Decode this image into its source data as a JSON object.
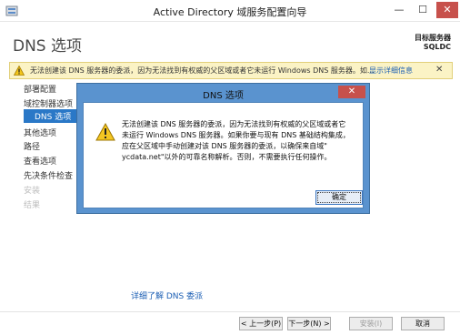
{
  "window": {
    "title": "Active Directory 域服务配置向导",
    "min_label": "—",
    "max_label": "☐",
    "close_label": "✕"
  },
  "header": {
    "page_title": "DNS 选项",
    "target_label": "目标服务器",
    "target_server": "SQLDC"
  },
  "warning": {
    "text": "无法创建该 DNS 服务器的委派，因为无法找到有权威的父区域或者它未运行 Windows DNS 服务器。如...",
    "link": "显示详细信息",
    "close": "✕"
  },
  "sidebar": {
    "items": [
      {
        "label": "部署配置",
        "state": "normal"
      },
      {
        "label": "域控制器选项",
        "state": "normal"
      },
      {
        "label": "DNS 选项",
        "state": "active"
      },
      {
        "label": "其他选项",
        "state": "normal"
      },
      {
        "label": "路径",
        "state": "normal"
      },
      {
        "label": "查看选项",
        "state": "normal"
      },
      {
        "label": "先决条件检查",
        "state": "normal"
      },
      {
        "label": "安装",
        "state": "disabled"
      },
      {
        "label": "结果",
        "state": "disabled"
      }
    ]
  },
  "main": {
    "learn_more": "详细了解 DNS 委派"
  },
  "footer": {
    "prev": "< 上一步(P)",
    "next": "下一步(N) >",
    "install": "安装(I)",
    "cancel": "取消"
  },
  "modal": {
    "title": "DNS 选项",
    "close": "✕",
    "message_lines": [
      "无法创建该 DNS 服务器的委派，因为无法找到有权威的父区域或者它",
      "未运行 Windows DNS 服务器。如果你要与现有 DNS 基础结构集成，",
      "应在父区域中手动创建对该 DNS 服务器的委派，以确保来自域\"",
      "ycdata.net\"以外的可靠名称解析。否则，不需要执行任何操作。"
    ],
    "ok": "确定"
  },
  "colors": {
    "accent": "#2a78c7",
    "modal_frame": "#5a93cf",
    "warning_bg": "#fbf3c5",
    "close_red": "#c7514c",
    "link": "#1c5fb4"
  },
  "icons": {
    "app": "server-manager-icon",
    "warning": "warning-triangle-icon"
  }
}
